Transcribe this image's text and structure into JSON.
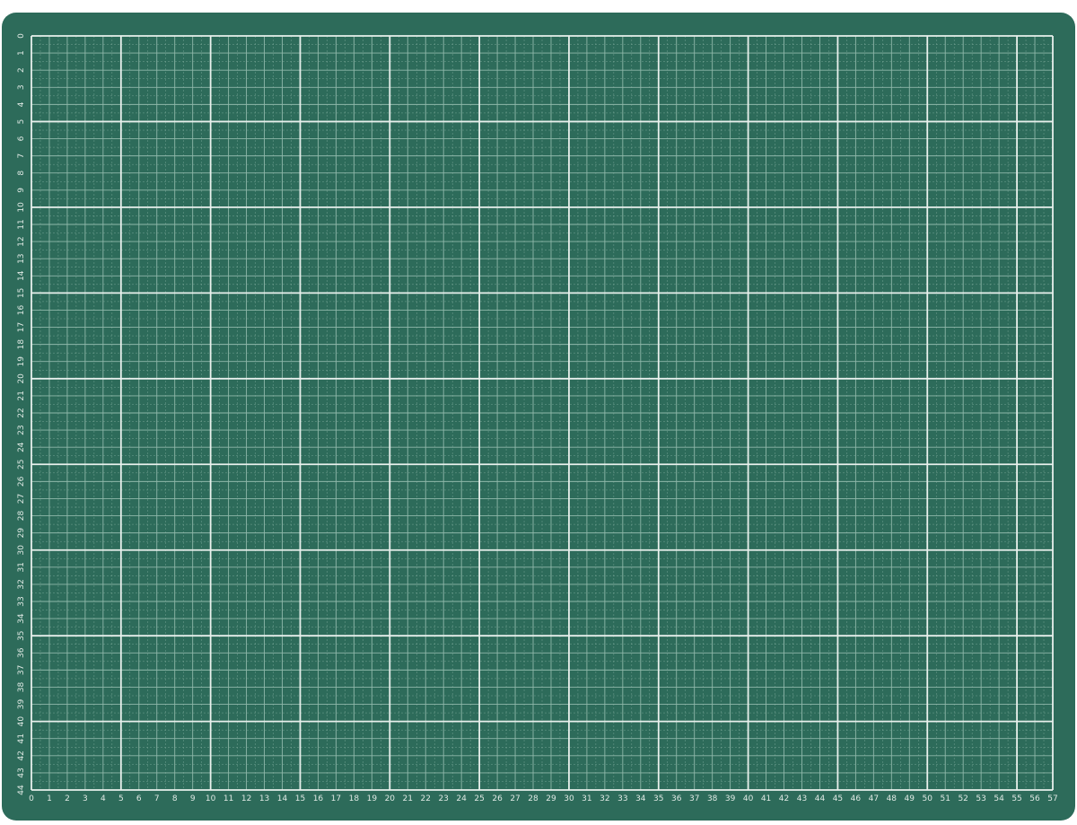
{
  "mat": {
    "colors": {
      "mat": "#2d6b5a",
      "background": "#ffffff",
      "fine_line": "#8fb8aa",
      "major_line": "#e8f0ec",
      "label": "#dfe9e4"
    },
    "grid": {
      "columns": 57,
      "rows": 44,
      "major_every": 5
    },
    "bottom_ruler": {
      "labels": [
        "0",
        "1",
        "2",
        "3",
        "4",
        "5",
        "6",
        "7",
        "8",
        "9",
        "10",
        "11",
        "12",
        "13",
        "14",
        "15",
        "16",
        "17",
        "18",
        "19",
        "20",
        "21",
        "22",
        "23",
        "24",
        "25",
        "26",
        "27",
        "28",
        "29",
        "30",
        "31",
        "32",
        "33",
        "34",
        "35",
        "36",
        "37",
        "38",
        "39",
        "40",
        "41",
        "42",
        "43",
        "44",
        "45",
        "46",
        "47",
        "48",
        "49",
        "50",
        "51",
        "52",
        "53",
        "54",
        "55",
        "56",
        "57"
      ]
    },
    "left_ruler": {
      "labels": [
        "0",
        "1",
        "2",
        "3",
        "4",
        "5",
        "6",
        "7",
        "8",
        "9",
        "10",
        "11",
        "12",
        "13",
        "14",
        "15",
        "16",
        "17",
        "18",
        "19",
        "20",
        "21",
        "22",
        "23",
        "24",
        "25",
        "26",
        "27",
        "28",
        "29",
        "30",
        "31",
        "32",
        "33",
        "34",
        "35",
        "36",
        "37",
        "38",
        "39",
        "40",
        "41",
        "42",
        "43",
        "44"
      ]
    }
  }
}
